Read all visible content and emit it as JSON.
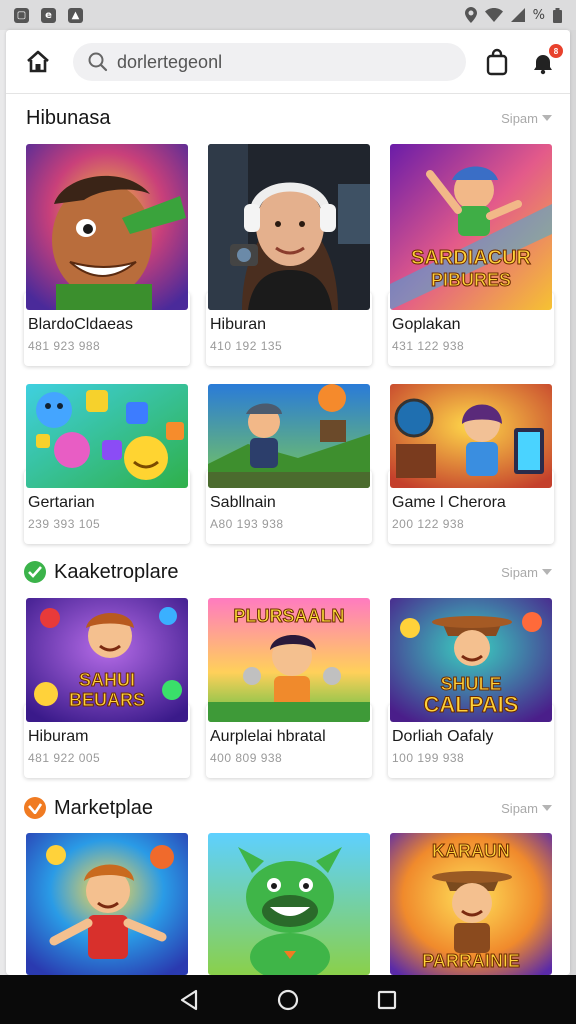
{
  "status_bar": {
    "battery": "%"
  },
  "header": {
    "search_value": "dorlertegeonl",
    "notif_count": "8"
  },
  "sections": [
    {
      "title": "Hibunasa",
      "see_all": "Sipam",
      "cards": [
        {
          "title": "BlardoCldaeas",
          "meta": "481 923 988"
        },
        {
          "title": "Hiburan",
          "meta": "410 192 135"
        },
        {
          "title": "Goplakan",
          "meta": "431 122 938"
        },
        {
          "title": "Gertarian",
          "meta": "239 393 105"
        },
        {
          "title": "Sabllnain",
          "meta": "A80 193 938"
        },
        {
          "title": "Game l Cherora",
          "meta": "200 122 938"
        }
      ]
    },
    {
      "title": "Kaaketroplare",
      "see_all": "Sipam",
      "cards": [
        {
          "title": "Hiburam",
          "meta": "481 922 005"
        },
        {
          "title": "Aurplelai hbratal",
          "meta": "400 809 938"
        },
        {
          "title": "Dorliah Oafaly",
          "meta": "100 199 938"
        }
      ]
    },
    {
      "title": "Marketplae",
      "see_all": "Sipam",
      "cards": []
    }
  ],
  "thumb_text": {
    "t3": [
      "SARDIACUR",
      "PIBURES"
    ],
    "s2_1": [
      "SAHUI",
      "BEUARS"
    ],
    "s2_2": [
      "PLURSAALN"
    ],
    "s2_3": [
      "SHULE",
      "CALPAIS"
    ],
    "s3_3": [
      "KARAUN",
      "PARRAINIE"
    ]
  },
  "colors": {
    "accent_green": "#3bb34a",
    "accent_orange": "#f07b22",
    "badge": "#e8412c"
  },
  "icons": {
    "home": "home-icon",
    "search": "search-icon",
    "bag": "bag-icon",
    "notification": "notification-icon",
    "back": "back-icon",
    "home_nav": "home-nav-icon",
    "recents": "recents-icon"
  }
}
